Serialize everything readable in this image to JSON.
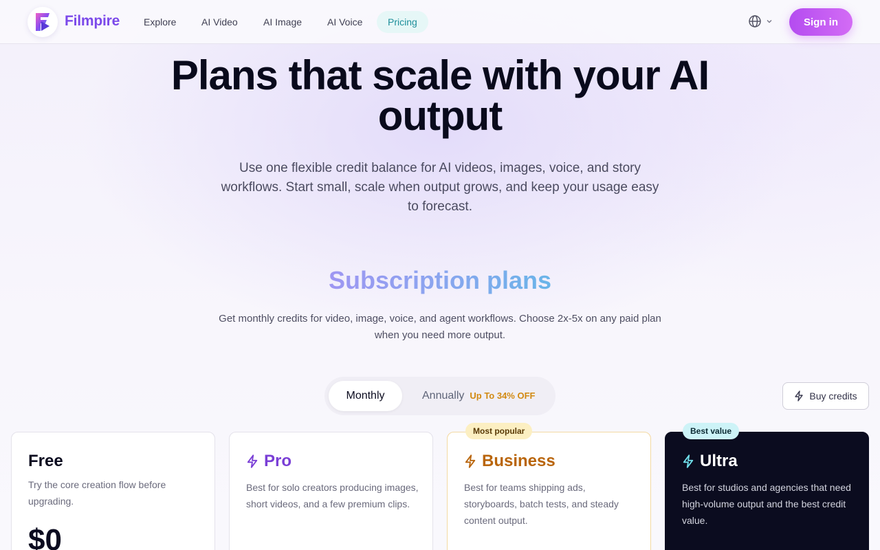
{
  "nav": {
    "brand": "Filmpire",
    "links": [
      "Explore",
      "AI Video",
      "AI Image",
      "AI Voice",
      "Pricing"
    ],
    "active_link": "Pricing",
    "sign_in": "Sign in"
  },
  "hero": {
    "title_line1": "Plans that scale with your AI",
    "title_line2": "output",
    "subtitle": "Use one flexible credit balance for AI videos, images, voice, and story workflows. Start small, scale when output grows, and keep your usage easy to forecast."
  },
  "plans_section": {
    "title": "Subscription plans",
    "subtitle": "Get monthly credits for video, image, voice, and agent workflows. Choose 2x-5x on any paid plan when you need more output."
  },
  "billing_toggle": {
    "monthly": "Monthly",
    "annually": "Annually",
    "annual_discount": "Up To 34% OFF",
    "selected": "Monthly"
  },
  "buy_credits": "Buy credits",
  "plans": [
    {
      "name": "Free",
      "description": "Try the core creation flow before upgrading.",
      "price": "$0",
      "badge": ""
    },
    {
      "name": "Pro",
      "description": "Best for solo creators producing images, short videos, and a few premium clips.",
      "price": "",
      "badge": ""
    },
    {
      "name": "Business",
      "description": "Best for teams shipping ads, storyboards, batch tests, and steady content output.",
      "price": "",
      "badge": "Most popular"
    },
    {
      "name": "Ultra",
      "description": "Best for studios and agencies that need high-volume output and the best credit value.",
      "price": "",
      "badge": "Best value"
    }
  ],
  "colors": {
    "brand_purple": "#7b49ea",
    "pro_purple": "#7a3fd6",
    "business_orange": "#b9650b",
    "ultra_bg": "#0b0c1f",
    "pricing_active_text": "#1e8f9b",
    "sign_in_gradient_start": "#b44cf0",
    "sign_in_gradient_end": "#d36cf5"
  },
  "icons": {
    "logo": "filmpire-logo-icon",
    "language": "globe-icon",
    "dropdown": "chevron-down-icon",
    "credits": "lightning-icon"
  }
}
